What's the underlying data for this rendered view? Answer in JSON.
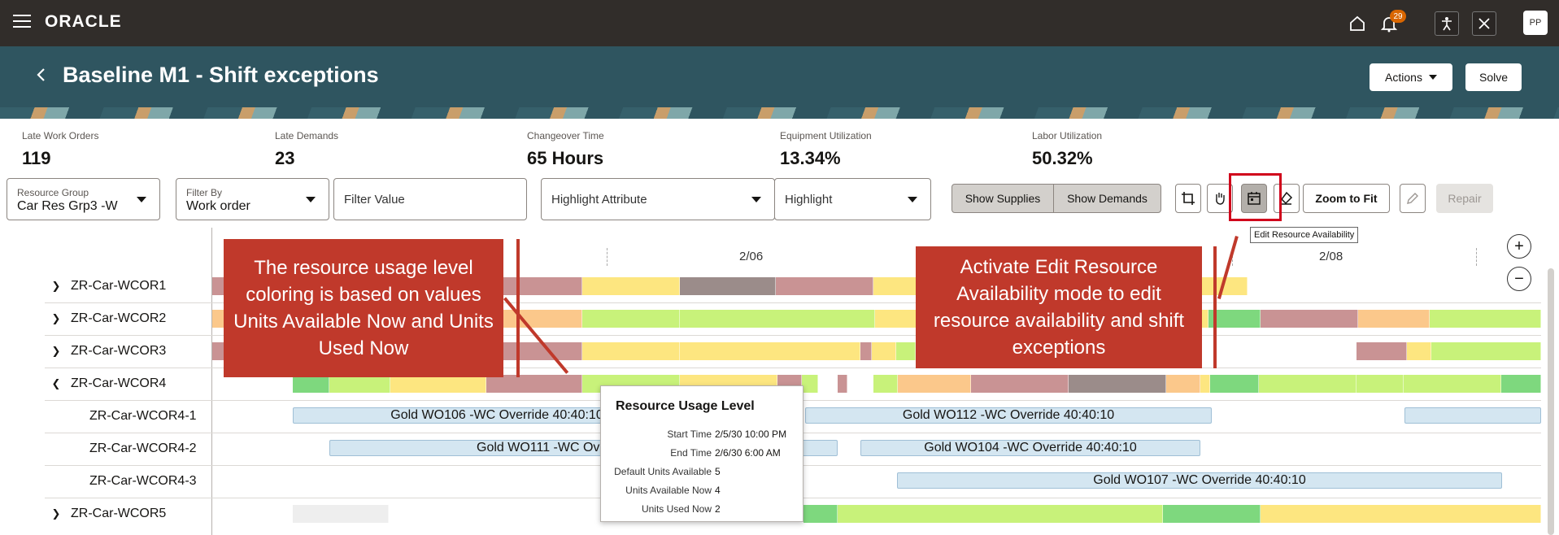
{
  "topbar": {
    "brand": "ORACLE",
    "notification_count": "29",
    "avatar_initials": "PP"
  },
  "header": {
    "back_icon": "chevron-left-icon",
    "title": "Baseline M1 - Shift exceptions",
    "actions_label": "Actions",
    "solve_label": "Solve"
  },
  "metrics": [
    {
      "label": "Late Work Orders",
      "value": "119"
    },
    {
      "label": "Late Demands",
      "value": "23"
    },
    {
      "label": "Changeover Time",
      "value": "65 Hours"
    },
    {
      "label": "Equipment Utilization",
      "value": "13.34%"
    },
    {
      "label": "Labor Utilization",
      "value": "50.32%"
    }
  ],
  "filters": {
    "resource_group_label": "Resource Group",
    "resource_group_value": "Car Res Grp3 -W",
    "filter_by_label": "Filter By",
    "filter_by_value": "Work order",
    "filter_value_placeholder": "Filter Value",
    "highlight_attribute_placeholder": "Highlight Attribute",
    "highlight_placeholder": "Highlight"
  },
  "toolbar": {
    "show_supplies": "Show Supplies",
    "show_demands": "Show Demands",
    "zoom_to_fit": "Zoom to Fit",
    "repair": "Repair",
    "tooltip": "Edit Resource Availability"
  },
  "timeline": {
    "dates": [
      "2/06",
      "2/08"
    ]
  },
  "rows": [
    {
      "label": "ZR-Car-WCOR1",
      "expander": "collapsed"
    },
    {
      "label": "ZR-Car-WCOR2",
      "expander": "collapsed"
    },
    {
      "label": "ZR-Car-WCOR3",
      "expander": "collapsed"
    },
    {
      "label": "ZR-Car-WCOR4",
      "expander": "expanded"
    },
    {
      "label": "ZR-Car-WCOR4-1",
      "expander": "none"
    },
    {
      "label": "ZR-Car-WCOR4-2",
      "expander": "none"
    },
    {
      "label": "ZR-Car-WCOR4-3",
      "expander": "none"
    },
    {
      "label": "ZR-Car-WCOR5",
      "expander": "collapsed"
    }
  ],
  "work_orders": [
    "Gold WO106 -WC Override 40:40:10",
    "Gold WO112 -WC Override 40:40:10",
    "Gold WO111 -WC Ov",
    "Gold WO104 -WC Override 40:40:10",
    "Gold WO107 -WC Override 40:40:10"
  ],
  "popup": {
    "title": "Resource Usage Level",
    "fields": [
      {
        "key": "Start Time",
        "value": "2/5/30 10:00 PM"
      },
      {
        "key": "End Time",
        "value": "2/6/30 6:00 AM"
      },
      {
        "key": "Default Units Available",
        "value": "5"
      },
      {
        "key": "Units Available Now",
        "value": "4"
      },
      {
        "key": "Units Used Now",
        "value": "2"
      }
    ]
  },
  "callouts": {
    "left": "The resource usage level coloring is based on values Units Available Now and Units Used Now",
    "right": "Activate Edit Resource Availability mode to edit resource availability and shift exceptions"
  },
  "colors": {
    "green": "#7ed87e",
    "light_green": "#c8f27a",
    "yellow": "#fde680",
    "orange": "#fbc88b",
    "rose": "#c99394",
    "gray": "#9b8c8a",
    "accent": "#c0392b"
  }
}
